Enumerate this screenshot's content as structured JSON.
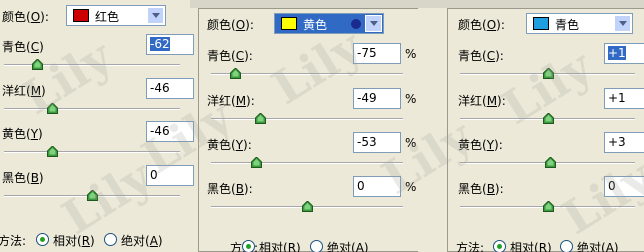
{
  "dialogs": [
    {
      "color_label": "颜色(",
      "color_key": "O",
      "color_close": "):",
      "selected": "红色",
      "swatch": "#cc0000",
      "rows": [
        {
          "label": "青色(",
          "key": "C",
          "close": ")",
          "value": "-62",
          "highlight": true,
          "pct": "",
          "level": 0.19
        },
        {
          "label": "洋红(",
          "key": "M",
          "close": ")",
          "value": "-46",
          "highlight": false,
          "pct": "",
          "level": 0.27
        },
        {
          "label": "黄色(",
          "key": "Y",
          "close": ")",
          "value": "-46",
          "highlight": false,
          "pct": "",
          "level": 0.27
        },
        {
          "label": "黑色(",
          "key": "B",
          "close": ")",
          "value": "0",
          "highlight": false,
          "pct": "",
          "level": 0.5
        }
      ],
      "method_label": "方法:",
      "relative": "相对(",
      "relative_key": "R",
      "relative_close": ")",
      "absolute": "绝对(",
      "absolute_key": "A",
      "absolute_close": ")"
    },
    {
      "color_label": "颜色(",
      "color_key": "O",
      "color_close": "):",
      "selected": "黄色",
      "swatch": "#ffff00",
      "rows": [
        {
          "label": "青色(",
          "key": "C",
          "close": "):",
          "value": "-75",
          "highlight": false,
          "pct": "%",
          "level": 0.125
        },
        {
          "label": "洋红(",
          "key": "M",
          "close": "):",
          "value": "-49",
          "highlight": false,
          "pct": "%",
          "level": 0.255
        },
        {
          "label": "黄色(",
          "key": "Y",
          "close": "):",
          "value": "-53",
          "highlight": false,
          "pct": "%",
          "level": 0.235
        },
        {
          "label": "黑色(",
          "key": "B",
          "close": "):",
          "value": "0",
          "highlight": false,
          "pct": "%",
          "level": 0.5
        }
      ],
      "method_label": "方法:",
      "relative": "相对(",
      "relative_key": "R",
      "relative_close": ")",
      "absolute": "绝对(",
      "absolute_key": "A",
      "absolute_close": ")"
    },
    {
      "color_label": "颜色(",
      "color_key": "O",
      "color_close": "):",
      "selected": "青色",
      "swatch": "#1e9fe0",
      "rows": [
        {
          "label": "青色(",
          "key": "C",
          "close": "):",
          "value": "+1",
          "highlight": true,
          "pct": "",
          "level": 0.505
        },
        {
          "label": "洋红(",
          "key": "M",
          "close": "):",
          "value": "+1",
          "highlight": false,
          "pct": "",
          "level": 0.505
        },
        {
          "label": "黄色(",
          "key": "Y",
          "close": "):",
          "value": "+3",
          "highlight": false,
          "pct": "",
          "level": 0.515
        },
        {
          "label": "黑色(",
          "key": "B",
          "close": "):",
          "value": "0",
          "highlight": false,
          "pct": "",
          "level": 0.5
        }
      ],
      "method_label": "方法:",
      "relative": "相对(",
      "relative_key": "R",
      "relative_close": ")",
      "absolute": "绝对(",
      "absolute_key": "A",
      "absolute_close": ")"
    }
  ],
  "watermark": "Lily"
}
